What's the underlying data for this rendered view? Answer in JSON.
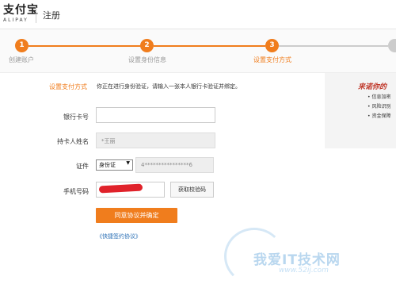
{
  "header": {
    "logo_cn": "支付宝",
    "logo_en": "ALIPAY",
    "title": "注册"
  },
  "steps": [
    {
      "number": "1",
      "label": "创建账户"
    },
    {
      "number": "2",
      "label": "设置身份信息"
    },
    {
      "number": "3",
      "label": "设置支付方式"
    }
  ],
  "colors": {
    "accent": "#f07d1d",
    "link": "#2a6fb5",
    "brand_red": "#c0392b"
  },
  "form": {
    "section_title": "设置支付方式",
    "notice": "你正在进行身份验证，请输入一张本人银行卡验证并绑定。",
    "bank_card": {
      "label": "银行卡号",
      "value": ""
    },
    "holder_name": {
      "label": "持卡人姓名",
      "value": "*王丽"
    },
    "id": {
      "label": "证件",
      "type": "身份证",
      "value": "4****************6"
    },
    "phone": {
      "label": "手机号码",
      "value": ""
    },
    "get_code_label": "获取校验码",
    "submit_label": "同意协议并确定",
    "agreement_link": "《快捷签约协议》"
  },
  "promo": {
    "title": "来诺你的",
    "items": [
      "• 信息加密",
      "• 风险识别",
      "• 资金保障"
    ]
  },
  "watermark": {
    "text": "我爱IT技术网",
    "url": "www.52ij.com"
  }
}
